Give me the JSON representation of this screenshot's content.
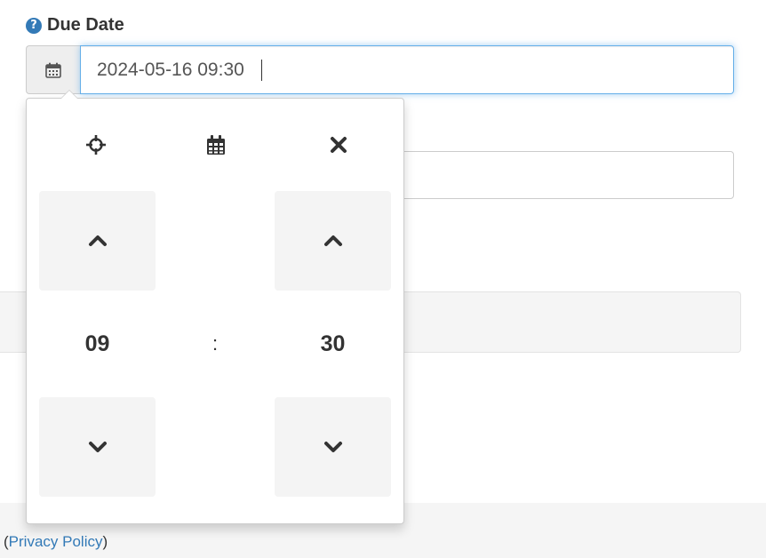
{
  "field": {
    "label": "Due Date",
    "help_glyph": "?",
    "value": "2024-05-16 09:30"
  },
  "picker": {
    "toolbar": {
      "today_icon": "crosshairs-icon",
      "calendar_icon": "calendar-icon",
      "clear_icon": "close-icon"
    },
    "hours": "09",
    "minutes": "30",
    "separator": ":"
  },
  "footer": {
    "open_paren": "(",
    "privacy_link": "Privacy Policy",
    "close_paren": ")"
  },
  "colors": {
    "accent": "#337ab7",
    "focus_border": "#66afe9",
    "button_bg": "#f4f4f4"
  }
}
